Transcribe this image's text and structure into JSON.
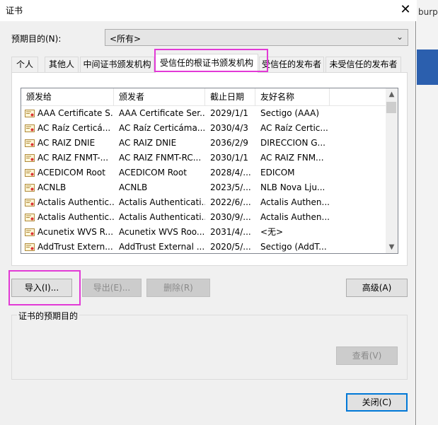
{
  "window": {
    "title": "证书",
    "close_glyph": "✕"
  },
  "background_window": {
    "tab_text": "burp"
  },
  "purpose": {
    "label": "预期目的(N):",
    "value": "<所有>",
    "arrow_glyph": "⌄"
  },
  "tabs": [
    {
      "label": "个人",
      "active": false
    },
    {
      "label": "其他人",
      "active": false
    },
    {
      "label": "中间证书颁发机构",
      "active": false
    },
    {
      "label": "受信任的根证书颁发机构",
      "active": true
    },
    {
      "label": "受信任的发布者",
      "active": false
    },
    {
      "label": "未受信任的发布者",
      "active": false
    }
  ],
  "table": {
    "columns": [
      "颁发给",
      "颁发者",
      "截止日期",
      "友好名称"
    ],
    "rows": [
      [
        "AAA Certificate S...",
        "AAA Certificate Ser...",
        "2029/1/1",
        "Sectigo (AAA)"
      ],
      [
        "AC Raíz Certicá...",
        "AC Raíz Certicáma...",
        "2030/4/3",
        "AC Raíz Certic..."
      ],
      [
        "AC RAIZ DNIE",
        "AC RAIZ DNIE",
        "2036/2/9",
        "DIRECCION G..."
      ],
      [
        "AC RAIZ FNMT-...",
        "AC RAIZ FNMT-RC...",
        "2030/1/1",
        "AC RAIZ FNM..."
      ],
      [
        "ACEDICOM Root",
        "ACEDICOM Root",
        "2028/4/...",
        "EDICOM"
      ],
      [
        "ACNLB",
        "ACNLB",
        "2023/5/...",
        "NLB Nova Lju..."
      ],
      [
        "Actalis Authentic...",
        "Actalis Authenticati...",
        "2022/6/...",
        "Actalis Authen..."
      ],
      [
        "Actalis Authentic...",
        "Actalis Authenticati...",
        "2030/9/...",
        "Actalis Authen..."
      ],
      [
        "Acunetix WVS R...",
        "Acunetix WVS Roo...",
        "2031/4/...",
        "<无>"
      ],
      [
        "AddTrust Extern...",
        "AddTrust External ...",
        "2020/5/...",
        "Sectigo (AddT..."
      ]
    ]
  },
  "scrollbar": {
    "up_glyph": "▲",
    "down_glyph": "▼"
  },
  "buttons": {
    "import": "导入(I)...",
    "export": "导出(E)...",
    "remove": "删除(R)",
    "advanced": "高级(A)",
    "view": "查看(V)",
    "close": "关闭(C)"
  },
  "purposes_group": {
    "label": "证书的预期目的"
  },
  "colors": {
    "highlight": "#e23ad6",
    "default_button_border": "#0078d7",
    "accent_strip": "#2b5fae"
  }
}
